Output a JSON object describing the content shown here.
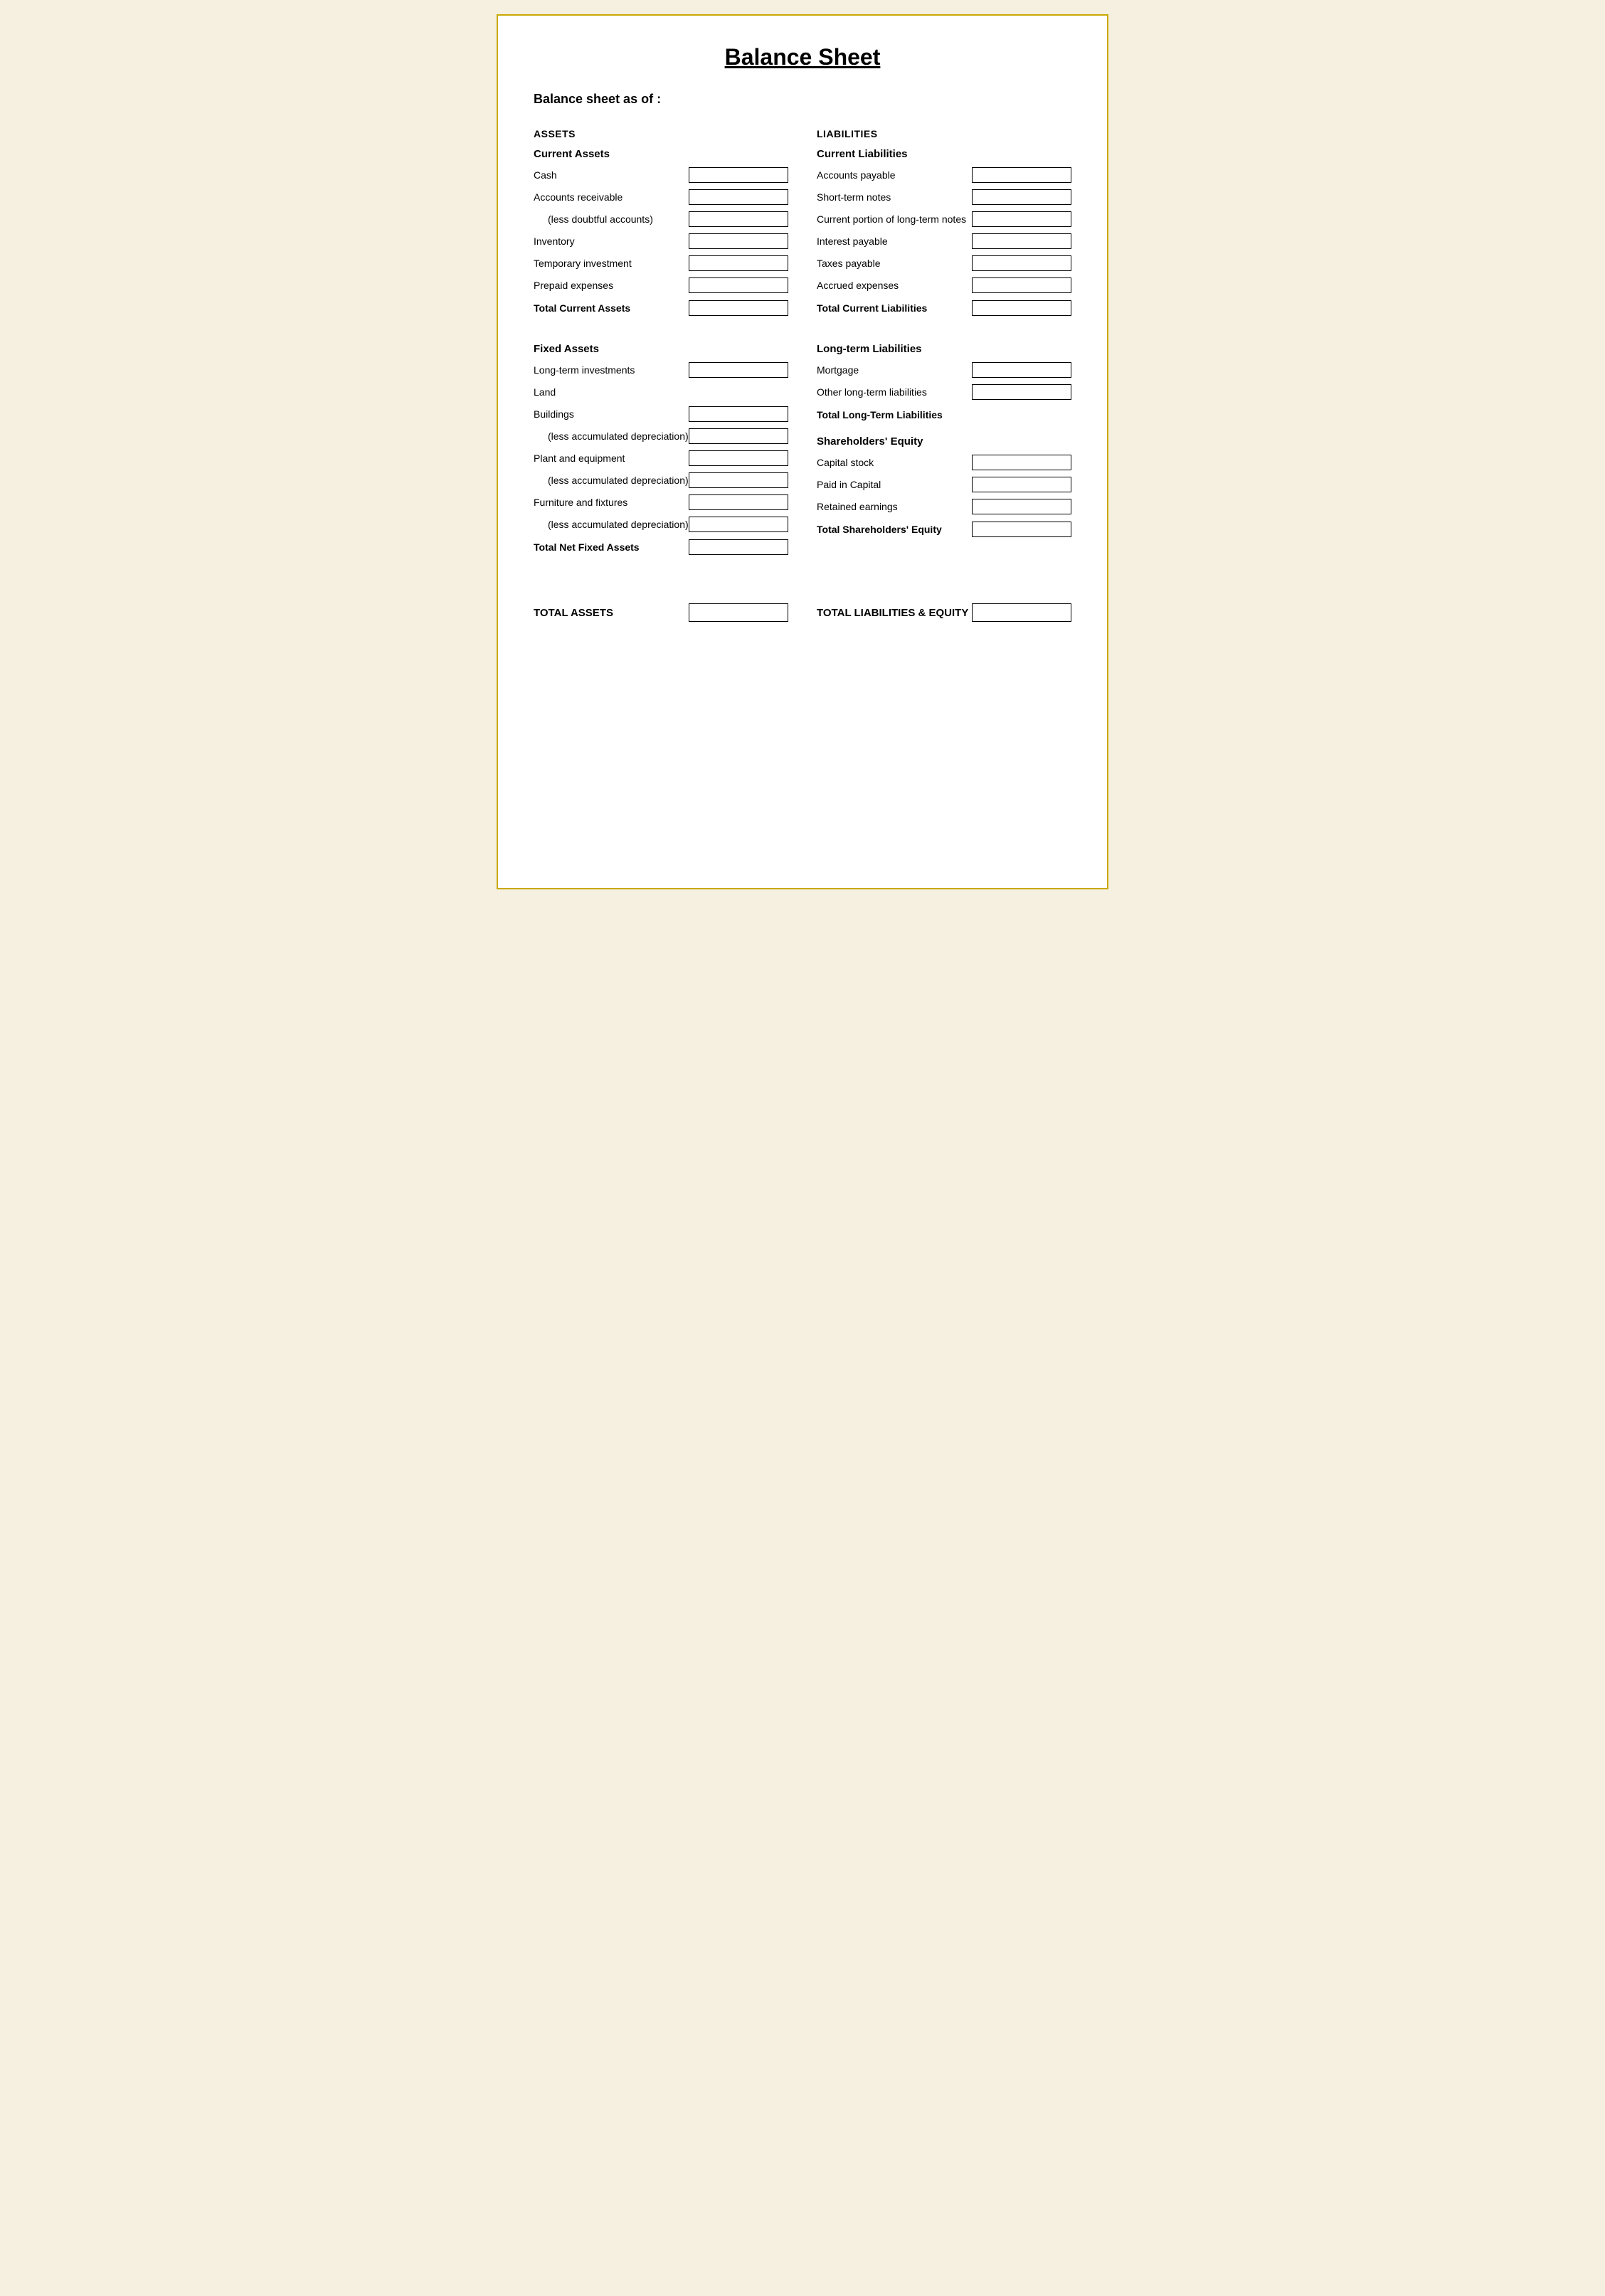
{
  "page": {
    "title": "Balance Sheet",
    "subtitle": "Balance sheet as of :"
  },
  "assets": {
    "sectionHeader": "ASSETS",
    "currentAssets": {
      "header": "Current Assets",
      "items": [
        {
          "label": "Cash",
          "indent": false
        },
        {
          "label": "Accounts receivable",
          "indent": false
        },
        {
          "label": "(less doubtful accounts)",
          "indent": true
        },
        {
          "label": "Inventory",
          "indent": false
        },
        {
          "label": "Temporary investment",
          "indent": false
        },
        {
          "label": "Prepaid expenses",
          "indent": false
        }
      ],
      "total": "Total Current Assets"
    },
    "fixedAssets": {
      "header": "Fixed Assets",
      "items": [
        {
          "label": "Long-term investments",
          "indent": false
        },
        {
          "label": "Land",
          "indent": false
        },
        {
          "label": "Buildings",
          "indent": false
        },
        {
          "label": "(less accumulated depreciation)",
          "indent": true
        },
        {
          "label": "Plant and equipment",
          "indent": false
        },
        {
          "label": "(less accumulated depreciation)",
          "indent": true
        },
        {
          "label": "Furniture and fixtures",
          "indent": false
        },
        {
          "label": "(less accumulated depreciation)",
          "indent": true
        }
      ],
      "total": "Total Net Fixed Assets"
    }
  },
  "liabilities": {
    "sectionHeader": "LIABILITIES",
    "currentLiabilities": {
      "header": "Current Liabilities",
      "items": [
        {
          "label": "Accounts payable"
        },
        {
          "label": "Short-term notes"
        },
        {
          "label": "Current portion of long-term notes"
        },
        {
          "label": "Interest payable"
        },
        {
          "label": "Taxes payable"
        },
        {
          "label": "Accrued expenses"
        }
      ],
      "total": "Total Current Liabilities"
    },
    "longTermLiabilities": {
      "header": "Long-term Liabilities",
      "items": [
        {
          "label": "Mortgage"
        },
        {
          "label": "Other long-term liabilities"
        }
      ],
      "total": "Total Long-Term Liabilities"
    },
    "shareholdersEquity": {
      "header": "Shareholders' Equity",
      "items": [
        {
          "label": "Capital stock"
        },
        {
          "label": "Paid in Capital"
        },
        {
          "label": "Retained earnings"
        }
      ],
      "total": "Total Shareholders' Equity"
    }
  },
  "totals": {
    "assets": "TOTAL ASSETS",
    "liabilitiesEquity": "TOTAL LIABILITIES & EQUITY"
  }
}
